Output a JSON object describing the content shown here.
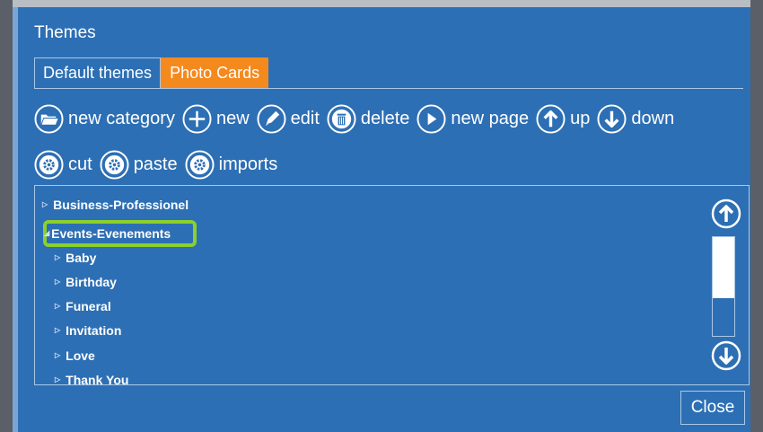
{
  "dialog": {
    "title": "Themes"
  },
  "tabs": [
    {
      "label": "Default themes",
      "active": false
    },
    {
      "label": "Photo Cards",
      "active": true
    }
  ],
  "toolbar": {
    "new_category": "new category",
    "new": "new",
    "edit": "edit",
    "delete": "delete",
    "new_page": "new page",
    "up": "up",
    "down": "down",
    "cut": "cut",
    "paste": "paste",
    "imports": "imports"
  },
  "tree": {
    "items": [
      {
        "label": "Business-Professionel",
        "level": 0,
        "expanded": false
      },
      {
        "label": "Events-Evenements",
        "level": 0,
        "expanded": true,
        "highlighted": true
      },
      {
        "label": "Baby",
        "level": 1
      },
      {
        "label": "Birthday",
        "level": 1
      },
      {
        "label": "Funeral",
        "level": 1
      },
      {
        "label": "Invitation",
        "level": 1
      },
      {
        "label": "Love",
        "level": 1
      },
      {
        "label": "Thank You",
        "level": 1
      }
    ]
  },
  "close_label": "Close",
  "colors": {
    "dialog_bg": "#2d6fb4",
    "active_tab": "#f48a1e",
    "highlight": "#8bd02c",
    "border": "#a9c7e6"
  },
  "scrollbar": {
    "thumb_fraction": 0.62,
    "position": 0.0
  }
}
